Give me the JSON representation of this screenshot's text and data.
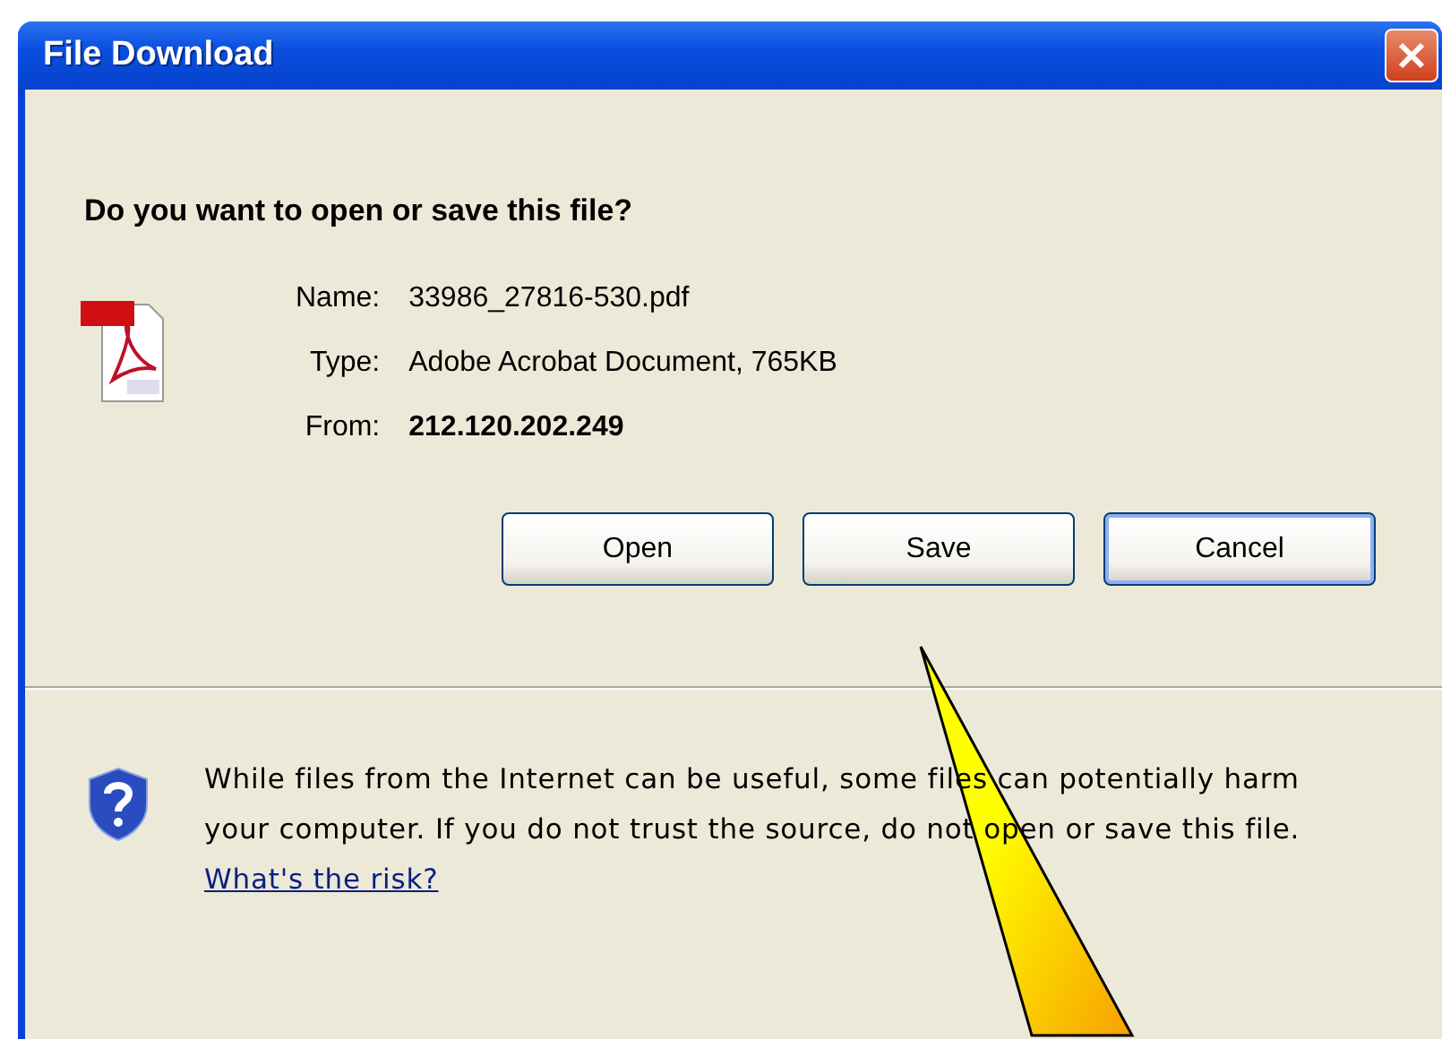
{
  "window": {
    "title": "File Download"
  },
  "prompt": "Do you want to open or save this file?",
  "details": [
    {
      "label": "Name:",
      "value": "33986_27816-530.pdf",
      "bold": false
    },
    {
      "label": "Type:",
      "value": "Adobe Acrobat Document, 765KB",
      "bold": false
    },
    {
      "label": "From:",
      "value": "212.120.202.249",
      "bold": true
    }
  ],
  "buttons": [
    {
      "label": "Open",
      "default": false
    },
    {
      "label": "Save",
      "default": false
    },
    {
      "label": "Cancel",
      "default": true
    }
  ],
  "warning": {
    "text": "While files from the Internet can be useful, some files can potentially harm your computer. If you do not trust the source, do not open or save this file.",
    "link": "What's the risk?"
  }
}
